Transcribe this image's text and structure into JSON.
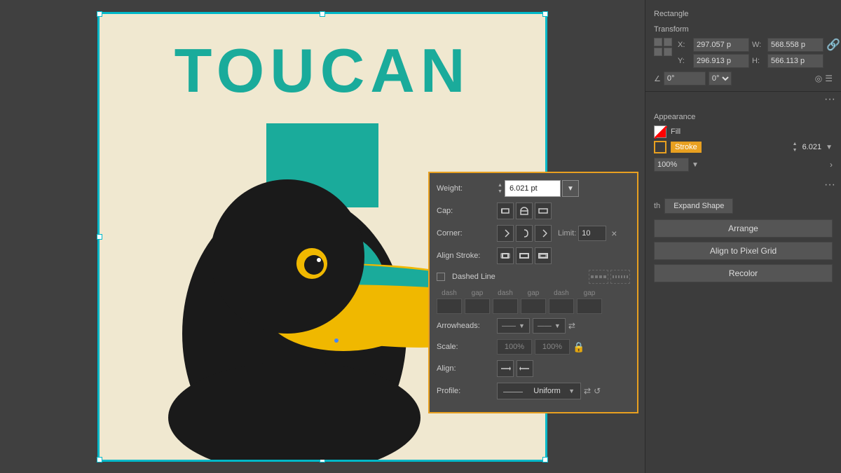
{
  "panel": {
    "rect_label": "Rectangle",
    "transform_label": "Transform",
    "x_label": "X:",
    "y_label": "Y:",
    "w_label": "W:",
    "h_label": "H:",
    "x_value": "297.057 p",
    "y_value": "296.913 p",
    "w_value": "568.558 p",
    "h_value": "566.113 p",
    "angle_value": "0°",
    "appearance_label": "Appearance",
    "fill_label": "Fill",
    "stroke_label": "Stroke",
    "stroke_value": "6.021",
    "opacity_value": "100%"
  },
  "stroke_popup": {
    "weight_label": "Weight:",
    "weight_value": "6.021 pt",
    "cap_label": "Cap:",
    "corner_label": "Corner:",
    "corner_limit_label": "Limit:",
    "corner_limit_value": "10",
    "align_label": "Align Stroke:",
    "dashed_label": "Dashed Line",
    "dash_labels": [
      "dash",
      "gap",
      "dash",
      "gap",
      "dash",
      "gap"
    ],
    "arrowheads_label": "Arrowheads:",
    "scale_label": "Scale:",
    "scale_value1": "100%",
    "scale_value2": "100%",
    "align_arrows_label": "Align:",
    "profile_label": "Profile:",
    "profile_value": "Uniform"
  },
  "actions": {
    "expand_shape": "Expand Shape",
    "arrange": "Arrange",
    "align_pixel": "Align to Pixel Grid",
    "recolor": "Recolor"
  },
  "toucan": {
    "title": "TOUCAN"
  }
}
